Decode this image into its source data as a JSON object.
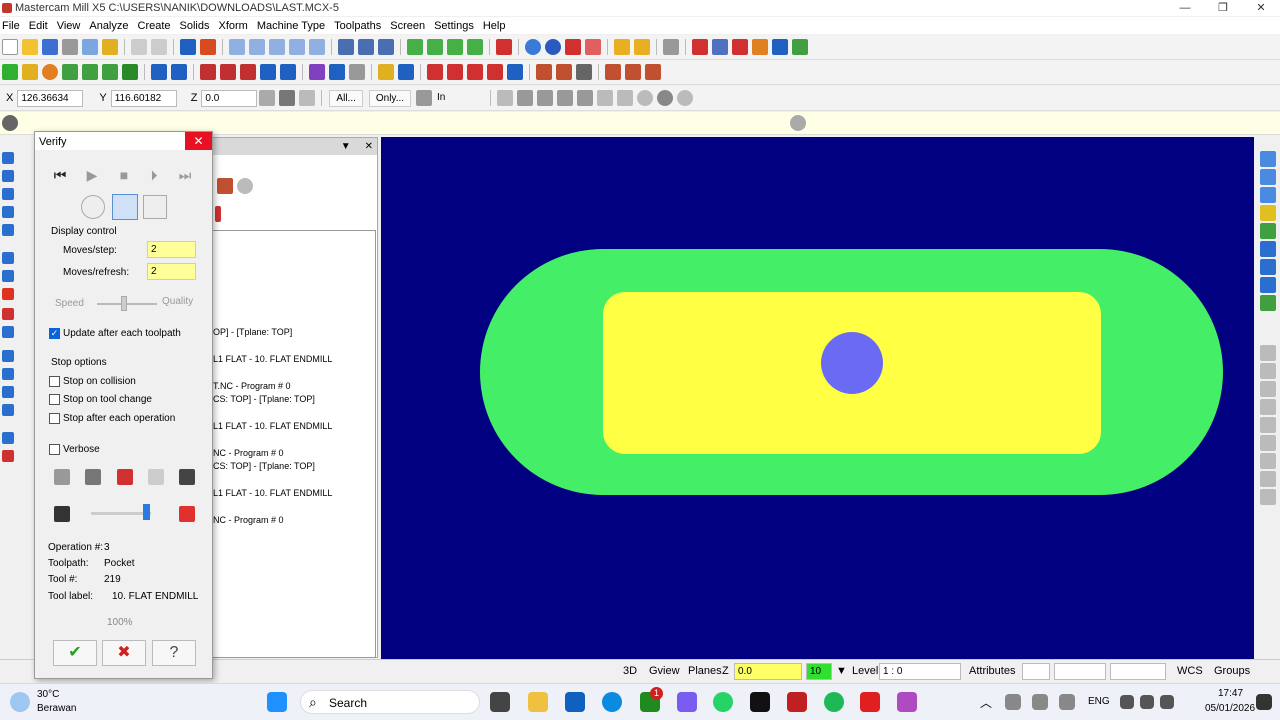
{
  "window": {
    "title": "Mastercam Mill X5  C:\\USERS\\NANIK\\DOWNLOADS\\LAST.MCX-5",
    "minimize": "—",
    "maximize": "❐",
    "close": "✕"
  },
  "menu": [
    "File",
    "Edit",
    "View",
    "Analyze",
    "Create",
    "Solids",
    "Xform",
    "Machine Type",
    "Toolpaths",
    "Screen",
    "Settings",
    "Help"
  ],
  "coords": {
    "x_label": "X",
    "x_value": "126.36634",
    "y_label": "Y",
    "y_value": "116.60182",
    "z_label": "Z",
    "z_value": "0.0",
    "all_btn": "All...",
    "only_btn": "Only...",
    "mode": "In"
  },
  "verify": {
    "title": "Verify",
    "close": "✕",
    "display_control": "Display control",
    "moves_step_label": "Moves/step:",
    "moves_step_value": "2",
    "moves_refresh_label": "Moves/refresh:",
    "moves_refresh_value": "2",
    "speed_label": "Speed",
    "quality_label": "Quality",
    "update_after": "Update after each toolpath",
    "stop_options": "Stop options",
    "stop_collision": "Stop on collision",
    "stop_tool_change": "Stop on tool change",
    "stop_each_op": "Stop after each operation",
    "verbose": "Verbose",
    "operation_label": "Operation #:",
    "operation_value": "3",
    "toolpath_label": "Toolpath:",
    "toolpath_value": "Pocket",
    "tool_label": "Tool #:",
    "tool_value": "219",
    "tool_name_label": "Tool label:",
    "tool_name_value": "10. FLAT ENDMILL",
    "progress": "100%",
    "ok": "✔",
    "cancel": "✖",
    "help": "?"
  },
  "ops_tree": [
    "OP] - [Tplane: TOP]",
    "L1 FLAT -    10. FLAT ENDMILL",
    "T.NC - Program # 0",
    "CS: TOP] - [Tplane: TOP]",
    "L1 FLAT -    10. FLAT ENDMILL",
    "NC - Program # 0",
    "CS: TOP] - [Tplane: TOP]",
    "L1 FLAT -    10. FLAT ENDMILL",
    "NC - Program # 0"
  ],
  "status": {
    "view3d": "3D",
    "gview": "Gview",
    "planes": "Planes",
    "z_label": "Z",
    "z_value": "0.0",
    "color_value": "10",
    "level_label": "Level",
    "level_value": "1 : 0",
    "attributes": "Attributes",
    "wcs": "WCS",
    "groups": "Groups"
  },
  "colors": {
    "viewport": "#000080",
    "stock": "#44ee66",
    "pocket": "#ffff44",
    "island": "#6a6af5"
  },
  "taskbar": {
    "weather_temp": "30°C",
    "weather_desc": "Berawan",
    "search": "Search",
    "lang": "ENG",
    "time": "17:47",
    "date": "05/01/2026",
    "badge": "1"
  }
}
